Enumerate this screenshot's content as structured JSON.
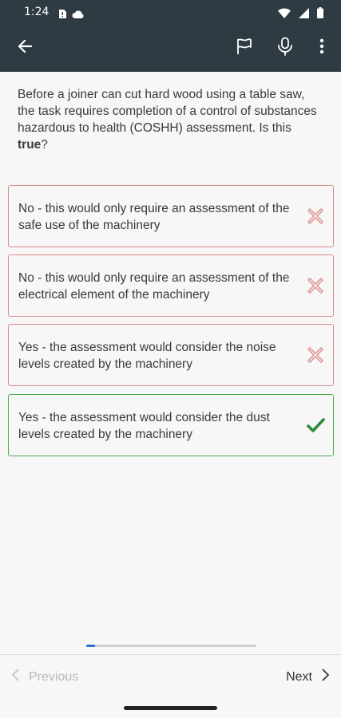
{
  "status_bar": {
    "time": "1:24",
    "left_icons": [
      "sim-alert-icon",
      "cloud-icon"
    ],
    "right_icons": [
      "wifi-icon",
      "signal-icon",
      "battery-icon"
    ]
  },
  "app_bar": {
    "icons": [
      "back-arrow-icon",
      "flag-icon",
      "microphone-icon",
      "more-vert-icon"
    ],
    "color": "#2f3b43"
  },
  "question": {
    "text_before": "Before a joiner can cut hard wood using a table saw, the task requires completion of a control of substances hazardous to health (COSHH) assessment. Is this ",
    "emphasis": "true",
    "text_after": "?"
  },
  "options": [
    {
      "line1": "No - this would only require an assessment of the",
      "line2": "safe use of the machinery",
      "status": "incorrect",
      "icon": "cross-icon"
    },
    {
      "line1": "No - this would only require an assessment of the",
      "line2": "electrical element of the machinery",
      "status": "incorrect",
      "icon": "cross-icon"
    },
    {
      "line1": "Yes - the assessment would consider the noise",
      "line2": "levels created by the machinery",
      "status": "incorrect",
      "icon": "cross-icon"
    },
    {
      "line1": "Yes - the assessment would consider the dust",
      "line2": "levels created by the machinery",
      "status": "correct",
      "icon": "check-icon"
    }
  ],
  "progress": {
    "fraction": 0.05,
    "color": "#2a6dd8"
  },
  "footer": {
    "previous_label": "Previous",
    "next_label": "Next"
  },
  "colors": {
    "incorrect": "#d98c8c",
    "correct": "#4caf50",
    "check": "#2e8b3a"
  }
}
